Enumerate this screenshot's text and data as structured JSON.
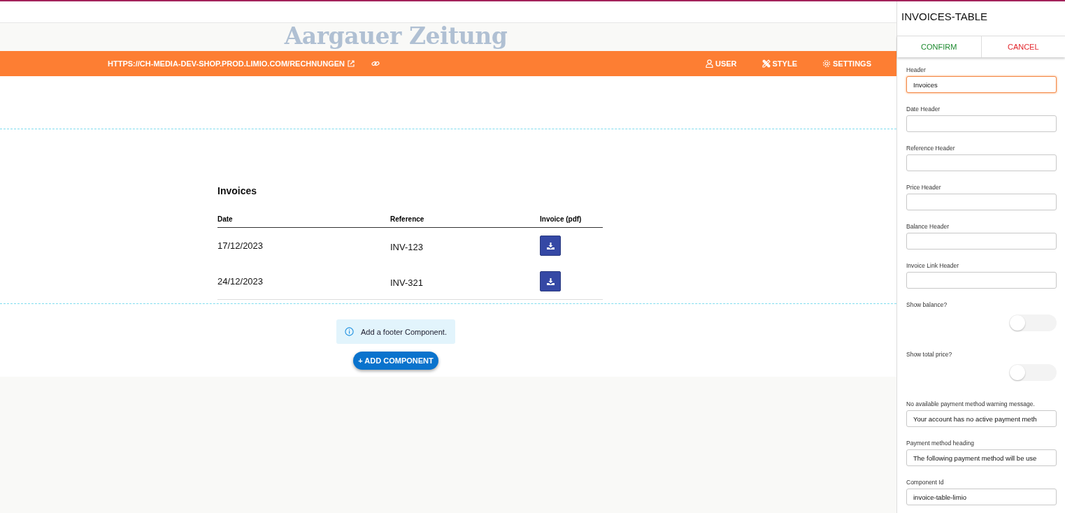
{
  "logo": "Aargauer Zeitung",
  "nav": {
    "url": "HTTPS://CH-MEDIA-DEV-SHOP.PROD.LIMIO.COM/RECHNUNGEN",
    "items": [
      {
        "label": "USER",
        "kind": "user"
      },
      {
        "label": "STYLE",
        "kind": "style"
      },
      {
        "label": "SETTINGS",
        "kind": "settings"
      }
    ]
  },
  "invoices": {
    "title": "Invoices",
    "columns": [
      "Date",
      "Reference",
      "Invoice (pdf)"
    ],
    "rows": [
      {
        "date": "17/12/2023",
        "reference": "INV-123"
      },
      {
        "date": "24/12/2023",
        "reference": "INV-321"
      }
    ]
  },
  "footer_notice": "Add a footer Component.",
  "add_button": "+ ADD COMPONENT",
  "panel": {
    "title": "INVOICES-TABLE",
    "confirm": "CONFIRM",
    "cancel": "CANCEL",
    "fields": [
      {
        "kind": "text",
        "label": "Header",
        "value": "Invoices",
        "focused": true
      },
      {
        "kind": "text",
        "label": "Date Header",
        "focused": false
      },
      {
        "kind": "text",
        "label": "Reference Header",
        "focused": false
      },
      {
        "kind": "text",
        "label": "Price Header",
        "focused": false
      },
      {
        "kind": "text",
        "label": "Balance Header",
        "focused": false
      },
      {
        "kind": "text",
        "label": "Invoice Link Header",
        "focused": false
      },
      {
        "kind": "toggle",
        "label": "Show balance?",
        "on": false
      },
      {
        "kind": "toggle",
        "label": "Show total price?",
        "on": false
      },
      {
        "kind": "text",
        "label": "No available payment method warning message.",
        "value": "Your account has no active payment meth",
        "focused": false
      },
      {
        "kind": "text",
        "label": "Payment method heading",
        "value": "The following payment method will be use",
        "focused": false
      },
      {
        "kind": "text",
        "label": "Component Id",
        "value": "invoice-table-limio",
        "focused": false
      }
    ]
  }
}
